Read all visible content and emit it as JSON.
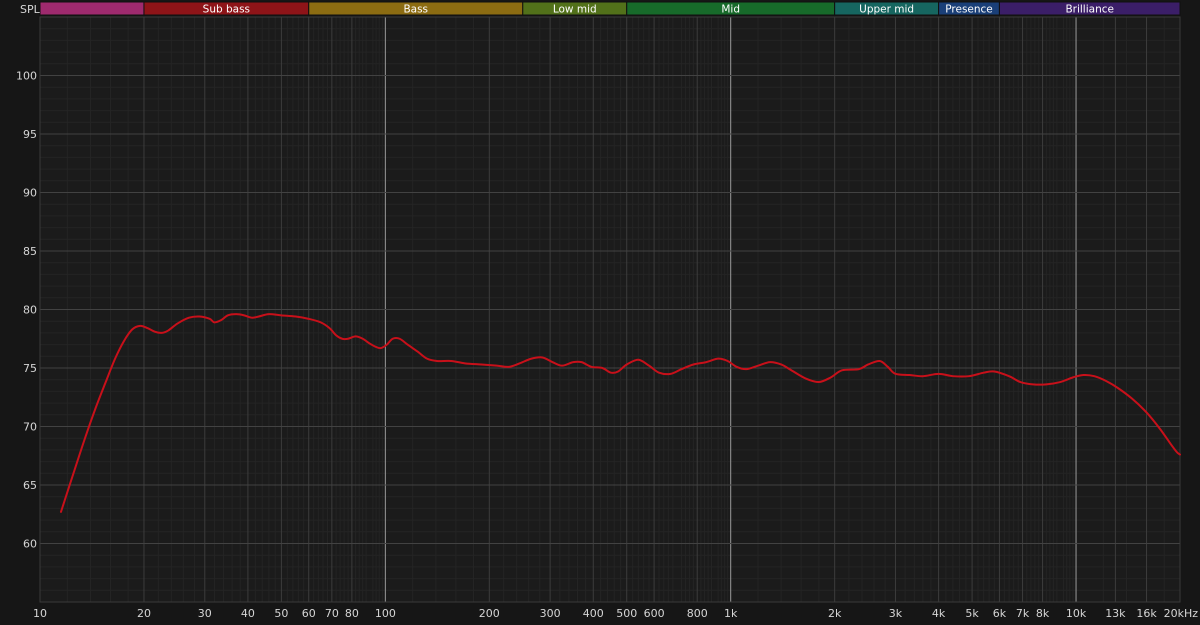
{
  "chart_data": {
    "type": "line",
    "title": "",
    "ylabel": "SPL",
    "xlabel": "",
    "x_scale": "log",
    "xlim": [
      10,
      20000
    ],
    "ylim": [
      55,
      105
    ],
    "grid": true,
    "y_ticks": [
      60,
      65,
      70,
      75,
      80,
      85,
      90,
      95,
      100
    ],
    "x_ticks": [
      {
        "value": 10,
        "label": "10"
      },
      {
        "value": 20,
        "label": "20"
      },
      {
        "value": 30,
        "label": "30"
      },
      {
        "value": 40,
        "label": "40"
      },
      {
        "value": 50,
        "label": "50"
      },
      {
        "value": 60,
        "label": "60"
      },
      {
        "value": 70,
        "label": "70"
      },
      {
        "value": 80,
        "label": "80"
      },
      {
        "value": 100,
        "label": "100"
      },
      {
        "value": 200,
        "label": "200"
      },
      {
        "value": 300,
        "label": "300"
      },
      {
        "value": 400,
        "label": "400"
      },
      {
        "value": 500,
        "label": "500"
      },
      {
        "value": 600,
        "label": "600"
      },
      {
        "value": 800,
        "label": "800"
      },
      {
        "value": 1000,
        "label": "1k"
      },
      {
        "value": 2000,
        "label": "2k"
      },
      {
        "value": 3000,
        "label": "3k"
      },
      {
        "value": 4000,
        "label": "4k"
      },
      {
        "value": 5000,
        "label": "5k"
      },
      {
        "value": 6000,
        "label": "6k"
      },
      {
        "value": 7000,
        "label": "7k"
      },
      {
        "value": 8000,
        "label": "8k"
      },
      {
        "value": 10000,
        "label": "10k"
      },
      {
        "value": 13000,
        "label": "13k"
      },
      {
        "value": 16000,
        "label": "16k"
      },
      {
        "value": 20000,
        "label": "20kHz"
      }
    ],
    "bands": [
      {
        "label": "",
        "from": 10,
        "to": 20,
        "color": "#9e2a6e"
      },
      {
        "label": "Sub bass",
        "from": 20,
        "to": 60,
        "color": "#8e1418"
      },
      {
        "label": "Bass",
        "from": 60,
        "to": 250,
        "color": "#8c6c12"
      },
      {
        "label": "Low mid",
        "from": 250,
        "to": 500,
        "color": "#52711a"
      },
      {
        "label": "Mid",
        "from": 500,
        "to": 2000,
        "color": "#176a2a"
      },
      {
        "label": "Upper mid",
        "from": 2000,
        "to": 4000,
        "color": "#166660"
      },
      {
        "label": "Presence",
        "from": 4000,
        "to": 6000,
        "color": "#1a3f78"
      },
      {
        "label": "Brilliance",
        "from": 6000,
        "to": 20000,
        "color": "#3b1e68"
      }
    ],
    "series": [
      {
        "color": "#c8101a",
        "points": [
          [
            11.5,
            62.7
          ],
          [
            12.5,
            66.0
          ],
          [
            13.5,
            69.0
          ],
          [
            14.5,
            71.6
          ],
          [
            15.5,
            73.8
          ],
          [
            16.5,
            75.8
          ],
          [
            17.5,
            77.3
          ],
          [
            18.5,
            78.3
          ],
          [
            19.5,
            78.6
          ],
          [
            20.5,
            78.4
          ],
          [
            21.5,
            78.1
          ],
          [
            22.5,
            78.0
          ],
          [
            23.5,
            78.2
          ],
          [
            25,
            78.8
          ],
          [
            27,
            79.3
          ],
          [
            29,
            79.4
          ],
          [
            31,
            79.2
          ],
          [
            32,
            78.9
          ],
          [
            33.5,
            79.1
          ],
          [
            35,
            79.5
          ],
          [
            37,
            79.6
          ],
          [
            39,
            79.5
          ],
          [
            41,
            79.3
          ],
          [
            43,
            79.4
          ],
          [
            46,
            79.6
          ],
          [
            50,
            79.5
          ],
          [
            55,
            79.4
          ],
          [
            60,
            79.2
          ],
          [
            65,
            78.9
          ],
          [
            69,
            78.4
          ],
          [
            72,
            77.8
          ],
          [
            75,
            77.5
          ],
          [
            78,
            77.5
          ],
          [
            82,
            77.7
          ],
          [
            86,
            77.5
          ],
          [
            90,
            77.1
          ],
          [
            94,
            76.8
          ],
          [
            97,
            76.7
          ],
          [
            101,
            77.0
          ],
          [
            105,
            77.5
          ],
          [
            110,
            77.5
          ],
          [
            116,
            77.0
          ],
          [
            124,
            76.4
          ],
          [
            132,
            75.8
          ],
          [
            141,
            75.6
          ],
          [
            155,
            75.6
          ],
          [
            170,
            75.4
          ],
          [
            190,
            75.3
          ],
          [
            210,
            75.2
          ],
          [
            228,
            75.1
          ],
          [
            245,
            75.4
          ],
          [
            265,
            75.8
          ],
          [
            285,
            75.9
          ],
          [
            305,
            75.5
          ],
          [
            325,
            75.2
          ],
          [
            350,
            75.5
          ],
          [
            370,
            75.5
          ],
          [
            395,
            75.1
          ],
          [
            425,
            75.0
          ],
          [
            450,
            74.6
          ],
          [
            472,
            74.7
          ],
          [
            500,
            75.3
          ],
          [
            540,
            75.7
          ],
          [
            580,
            75.2
          ],
          [
            620,
            74.6
          ],
          [
            670,
            74.5
          ],
          [
            720,
            74.9
          ],
          [
            780,
            75.3
          ],
          [
            850,
            75.5
          ],
          [
            920,
            75.8
          ],
          [
            980,
            75.6
          ],
          [
            1040,
            75.1
          ],
          [
            1110,
            74.9
          ],
          [
            1200,
            75.2
          ],
          [
            1300,
            75.5
          ],
          [
            1400,
            75.3
          ],
          [
            1500,
            74.8
          ],
          [
            1650,
            74.1
          ],
          [
            1800,
            73.8
          ],
          [
            1950,
            74.2
          ],
          [
            2100,
            74.8
          ],
          [
            2350,
            74.9
          ],
          [
            2500,
            75.3
          ],
          [
            2700,
            75.6
          ],
          [
            2850,
            75.1
          ],
          [
            3000,
            74.5
          ],
          [
            3300,
            74.4
          ],
          [
            3600,
            74.3
          ],
          [
            4000,
            74.5
          ],
          [
            4400,
            74.3
          ],
          [
            4900,
            74.3
          ],
          [
            5400,
            74.6
          ],
          [
            5800,
            74.7
          ],
          [
            6400,
            74.3
          ],
          [
            6900,
            73.8
          ],
          [
            7500,
            73.6
          ],
          [
            8200,
            73.6
          ],
          [
            9000,
            73.8
          ],
          [
            9800,
            74.2
          ],
          [
            10500,
            74.4
          ],
          [
            11300,
            74.3
          ],
          [
            12200,
            73.9
          ],
          [
            13200,
            73.3
          ],
          [
            14500,
            72.4
          ],
          [
            16000,
            71.2
          ],
          [
            17500,
            69.8
          ],
          [
            18800,
            68.5
          ],
          [
            19600,
            67.8
          ],
          [
            20000,
            67.6
          ]
        ]
      }
    ]
  }
}
